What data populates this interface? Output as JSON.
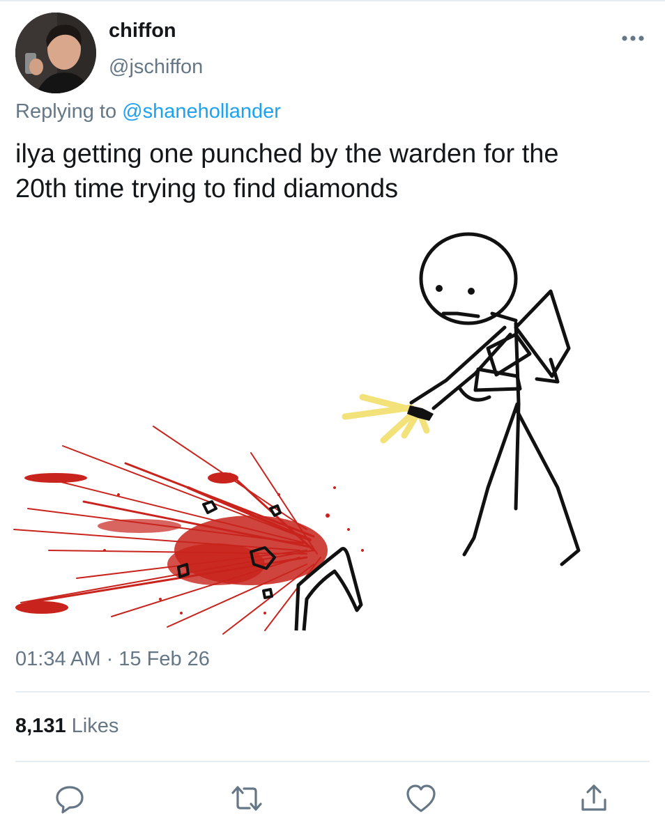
{
  "tweet": {
    "author": {
      "display_name": "chiffon",
      "handle": "@jschiffon"
    },
    "replying_prefix": "Replying to ",
    "replying_to": "@shanehollander",
    "text": "ilya getting one punched by the warden for the\n20th time trying to find diamonds",
    "timestamp": "01:34 AM · 15 Feb 26",
    "likes_count": "8,131",
    "likes_label": " Likes"
  },
  "actions": {
    "reply_icon": "reply-icon",
    "retweet_icon": "retweet-icon",
    "like_icon": "heart-icon",
    "share_icon": "share-icon"
  },
  "colors": {
    "link": "#1da1f2",
    "secondary_text": "#657786",
    "primary_text": "#14171a",
    "divider": "#e6ecf0",
    "blood": "#c8231c",
    "muzzle_flash": "#f3e27a"
  }
}
